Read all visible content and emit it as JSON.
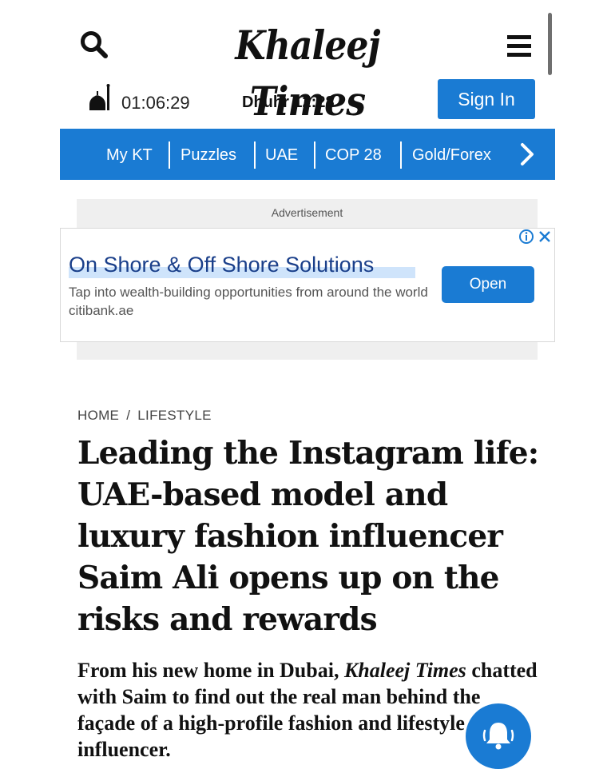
{
  "header": {
    "logo_text": "Khaleej Times",
    "icons": {
      "search": "search-icon",
      "menu": "hamburger-menu-icon"
    }
  },
  "prayer": {
    "icon": "mosque-icon",
    "countdown": "01:06:29",
    "next_prayer": "Dhuhr 12:28"
  },
  "auth": {
    "sign_in_label": "Sign In"
  },
  "nav": {
    "items": [
      "My KT",
      "Puzzles",
      "UAE",
      "COP 28",
      "Gold/Forex"
    ],
    "next_icon": "chevron-right-icon"
  },
  "ad": {
    "label": "Advertisement",
    "title": "On Shore & Off Shore Solutions",
    "description": "Tap into wealth-building opportunities from around the world citibank.ae",
    "cta_label": "Open",
    "icons": {
      "info": "info-icon",
      "close": "close-icon"
    }
  },
  "article": {
    "breadcrumb": {
      "home": "HOME",
      "separator": "/",
      "section": "LIFESTYLE"
    },
    "headline": "Leading the Instagram life: UAE-based model and luxury fashion influencer Saim Ali opens up on the risks and rewards",
    "standfirst": {
      "before": "From his new home in Dubai, ",
      "publication": "Khaleej Times",
      "after": " chatted with Saim to find out the real man behind the façade of a high-profile fashion and lifestyle influencer."
    }
  },
  "notifications": {
    "icon": "bell-icon"
  },
  "colors": {
    "brand_blue": "#1a7bd3",
    "ad_title": "#1a3f8a"
  }
}
